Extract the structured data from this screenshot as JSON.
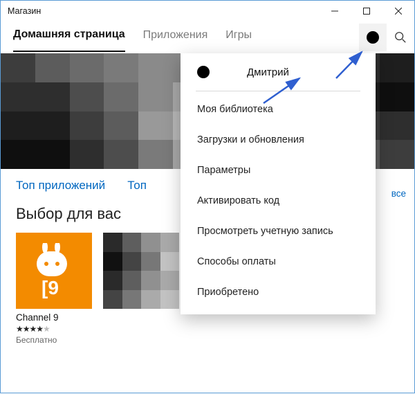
{
  "window_title": "Магазин",
  "nav": {
    "tabs": [
      {
        "label": "Домашняя страница",
        "active": true
      },
      {
        "label": "Приложения",
        "active": false
      },
      {
        "label": "Игры",
        "active": false
      }
    ]
  },
  "dropdown": {
    "username": "Дмитрий",
    "items": [
      "Моя библиотека",
      "Загрузки и обновления",
      "Параметры",
      "Активировать код",
      "Просмотреть учетную запись",
      "Способы оплаты",
      "Приобретено"
    ]
  },
  "section_links": [
    "Топ приложений",
    "Топ"
  ],
  "picks": {
    "title": "Выбор для вас",
    "see_all": "все",
    "apps": [
      {
        "name": "Channel 9",
        "rating_stars": 4,
        "rating_of": 5,
        "price": "Бесплатно"
      }
    ]
  },
  "icons": {
    "user": "user-avatar-icon",
    "search": "search-icon",
    "minimize": "minimize-icon",
    "maximize": "maximize-icon",
    "close": "close-icon"
  },
  "colors": {
    "accent": "#0067c0",
    "window_border": "#5a9bd5",
    "app_tile_orange": "#f38b00"
  }
}
